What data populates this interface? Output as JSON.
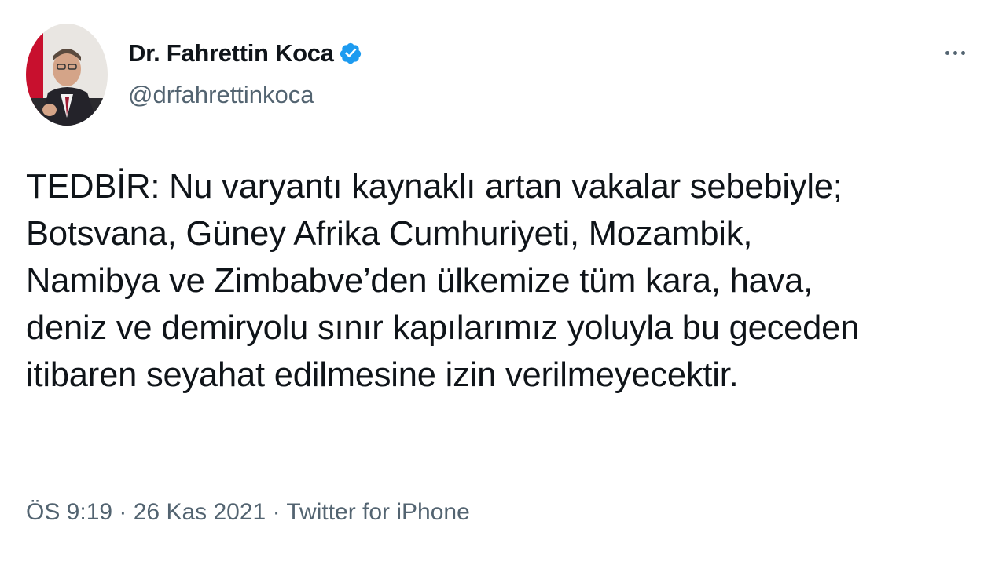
{
  "author": {
    "display_name": "Dr. Fahrettin Koca",
    "handle": "@drfahrettinkoca",
    "verified_icon": "verified-badge-icon",
    "avatar_icon": "profile-avatar"
  },
  "tweet": {
    "lines": [
      "TEDBİR: Nu varyantı kaynaklı artan vakalar sebebiyle;",
      "Botsvana, Güney Afrika Cumhuriyeti, Mozambik,",
      "Namibya ve Zimbabve’den ülkemize tüm kara, hava,",
      "deniz ve demiryolu sınır kapılarımız yoluyla bu geceden",
      "itibaren seyahat edilmesine izin verilmeyecektir."
    ]
  },
  "meta": {
    "time": "ÖS 9:19",
    "separator": " · ",
    "date": "26 Kas 2021",
    "source": "Twitter for iPhone"
  },
  "colors": {
    "text": "#0f1419",
    "secondary": "#536471",
    "verified": "#1d9bf0"
  }
}
